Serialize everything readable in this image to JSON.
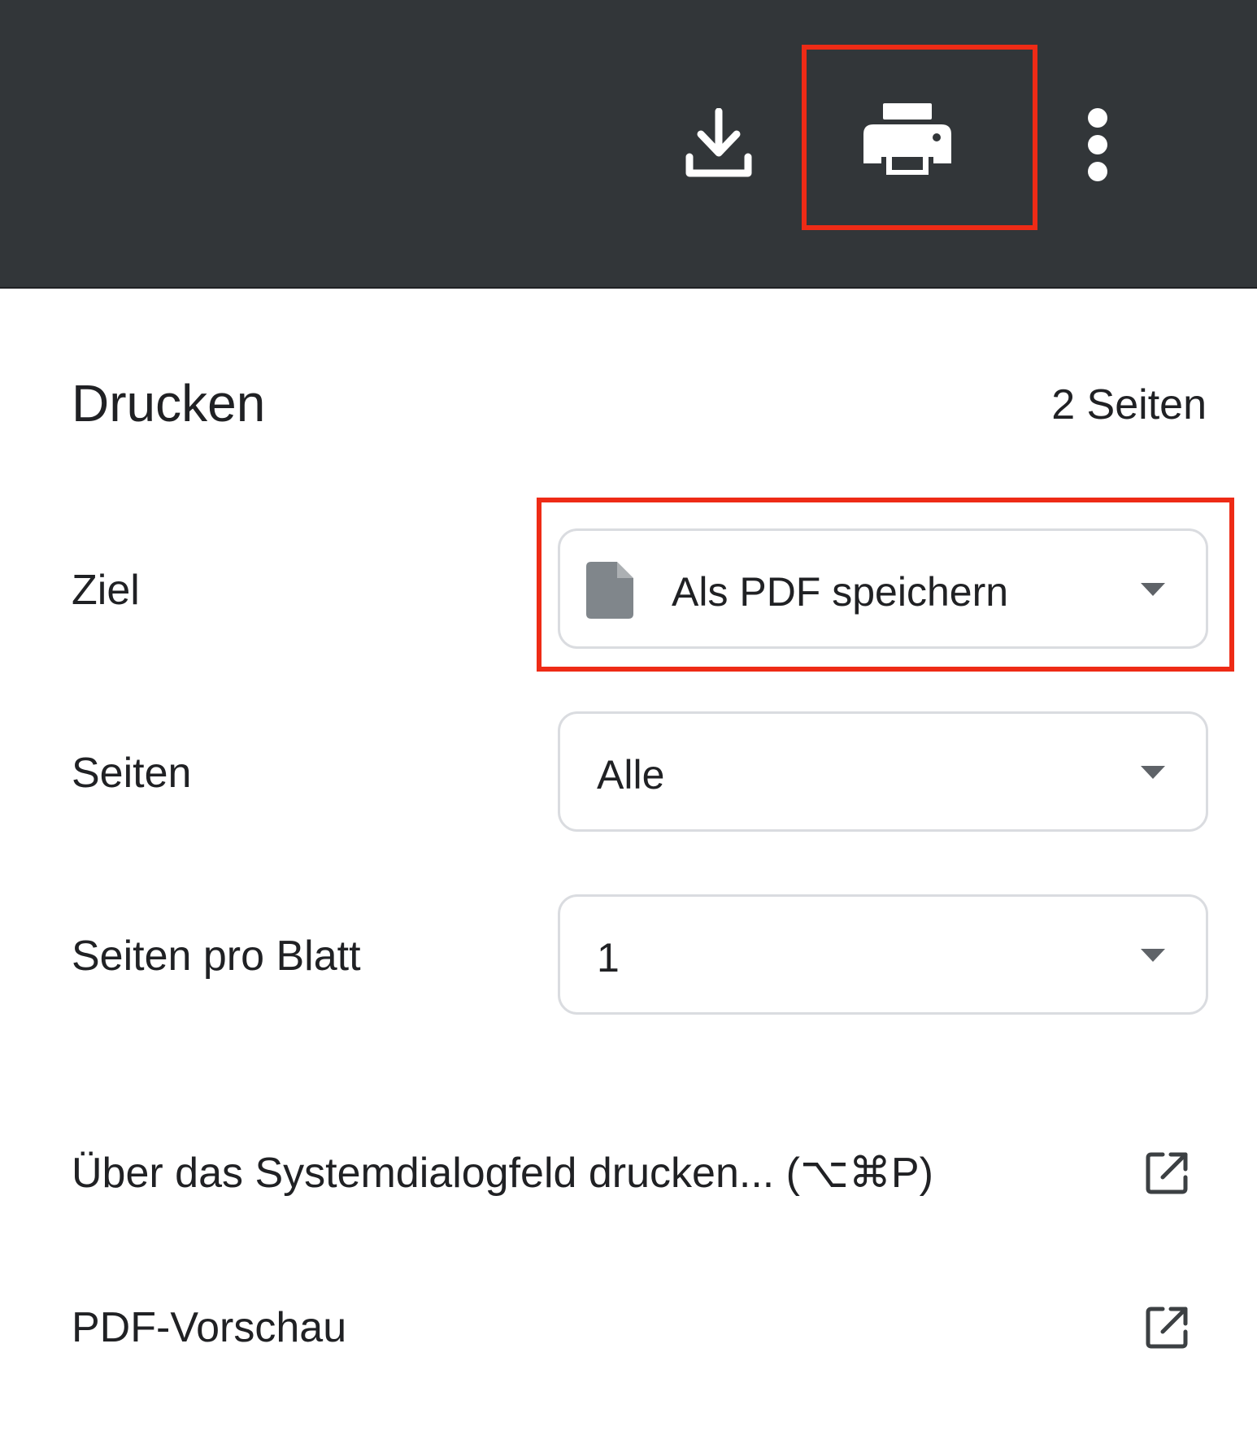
{
  "toolbar": {
    "download_icon": "download-icon",
    "print_icon": "print-icon",
    "more_icon": "more-vert-icon",
    "background": "#323639",
    "icon_color": "#ffffff"
  },
  "print_panel": {
    "title": "Drucken",
    "sheet_count": "2 Seiten",
    "destination": {
      "label": "Ziel",
      "value": "Als PDF speichern",
      "icon": "file-icon"
    },
    "pages": {
      "label": "Seiten",
      "value": "Alle"
    },
    "pages_per_sheet": {
      "label": "Seiten pro Blatt",
      "value": "1"
    },
    "links": {
      "system_dialog": "Über das Systemdialogfeld drucken... (⌥⌘P)",
      "pdf_preview": "PDF-Vorschau",
      "icon": "open-in-new-icon"
    }
  },
  "annotations": {
    "highlight_color": "#ee2b16"
  }
}
